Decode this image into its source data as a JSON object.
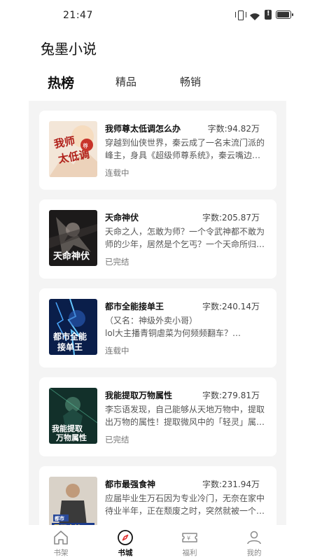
{
  "status_bar": {
    "time": "21:47"
  },
  "app": {
    "title": "兔墨小说"
  },
  "tabs": [
    {
      "label": "热榜",
      "active": true
    },
    {
      "label": "精品",
      "active": false
    },
    {
      "label": "畅销",
      "active": false
    }
  ],
  "books": [
    {
      "title": "我师尊太低调怎么办",
      "word_count": "字数:94.82万",
      "desc_1": "穿越到仙侠世界，秦云成了一名末流门派的",
      "desc_2": "峰主，身具《超级师尊系统》，秦云嘴边…",
      "status": "连载中",
      "cover_text": "我师尊太低调"
    },
    {
      "title": "天命神伏",
      "word_count": "字数:205.87万",
      "desc_1": "天命之人，怎敢为师？一个令武神都不敢为",
      "desc_2": "师的少年，居然是个乞丐？一个天命所归…",
      "status": "已完结",
      "cover_text": "天命神伏"
    },
    {
      "title": "都市全能接单王",
      "word_count": "字数:240.14万",
      "desc_1": "（又名：神级外卖小哥）",
      "desc_2": "lol大主播青铜虐菜为何频频翻车？…",
      "status": "连载中",
      "cover_text": "都市全能接单王"
    },
    {
      "title": "我能提取万物属性",
      "word_count": "字数:279.81万",
      "desc_1": "李忘语发现，自己能够从天地万物中，提取",
      "desc_2": "出万物的属性！提取微风中的「轻灵」属…",
      "status": "已完结",
      "cover_text": "我能提取万物属性"
    },
    {
      "title": "都市最强食神",
      "word_count": "字数:231.94万",
      "desc_1": "应届毕业生万石因为专业冷门，无奈在家中",
      "desc_2": "待业半年，正在颓废之时，突然就被一个…",
      "status": "",
      "cover_text": "都市最强食神"
    }
  ],
  "bottom_nav": [
    {
      "label": "书架",
      "icon": "home-icon",
      "active": false
    },
    {
      "label": "书城",
      "icon": "compass-icon",
      "active": true
    },
    {
      "label": "福利",
      "icon": "ticket-icon",
      "active": false
    },
    {
      "label": "我的",
      "icon": "person-icon",
      "active": false
    }
  ],
  "colors": {
    "background": "#ffffff",
    "content_bg": "#f4f4f4",
    "card_bg": "#ffffff",
    "active_text": "#111111",
    "muted_text": "#888888"
  }
}
